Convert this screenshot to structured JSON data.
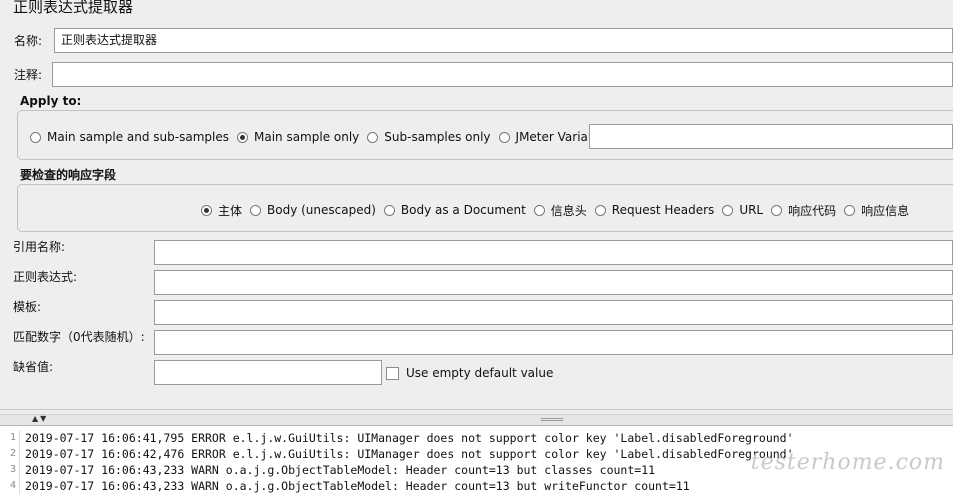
{
  "window": {
    "title": "正则表达式提取器"
  },
  "name_field": {
    "label": "名称:",
    "value": "正则表达式提取器"
  },
  "comment_field": {
    "label": "注释:",
    "value": ""
  },
  "apply_to": {
    "title": "Apply to:",
    "options": [
      "Main sample and sub-samples",
      "Main sample only",
      "Sub-samples only",
      "JMeter Variable"
    ],
    "selected": "Main sample only",
    "variable_value": ""
  },
  "field_to_check": {
    "title": "要检查的响应字段",
    "options": [
      "主体",
      "Body (unescaped)",
      "Body as a Document",
      "信息头",
      "Request Headers",
      "URL",
      "响应代码",
      "响应信息"
    ],
    "selected": "主体"
  },
  "form": {
    "ref_name": {
      "label": "引用名称:",
      "value": ""
    },
    "regex": {
      "label": "正则表达式:",
      "value": ""
    },
    "template": {
      "label": "模板:",
      "value": ""
    },
    "match_no": {
      "label": "匹配数字（0代表随机）:",
      "value": ""
    },
    "default_value": {
      "label": "缺省值:",
      "value": ""
    },
    "use_empty_default": {
      "label": "Use empty default value",
      "checked": false
    }
  },
  "log": {
    "lines": [
      {
        "num": "1",
        "text": "2019-07-17 16:06:41,795 ERROR e.l.j.w.GuiUtils: UIManager does not support color key 'Label.disabledForeground'"
      },
      {
        "num": "2",
        "text": "2019-07-17 16:06:42,476 ERROR e.l.j.w.GuiUtils: UIManager does not support color key 'Label.disabledForeground'"
      },
      {
        "num": "3",
        "text": "2019-07-17 16:06:43,233 WARN o.a.j.g.ObjectTableModel: Header count=13 but classes count=11"
      },
      {
        "num": "4",
        "text": "2019-07-17 16:06:43,233 WARN o.a.j.g.ObjectTableModel: Header count=13 but writeFunctor count=11"
      }
    ]
  },
  "watermark": "testerhome.com"
}
